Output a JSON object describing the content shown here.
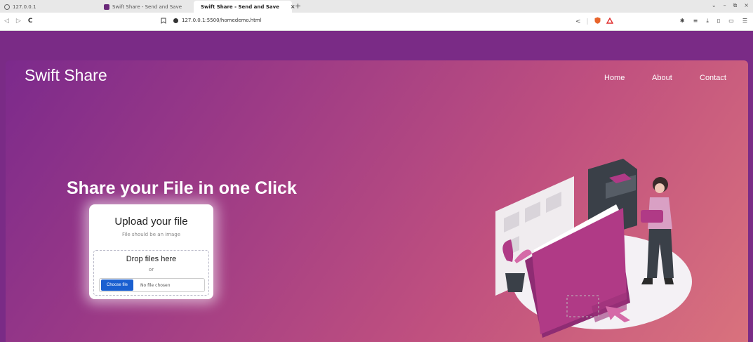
{
  "browser": {
    "tabs": [
      {
        "label": "127.0.0.1",
        "active": false
      },
      {
        "label": "Swift Share - Send and Save",
        "active": false
      },
      {
        "label": "Swift Share - Send and Save",
        "active": true
      }
    ],
    "new_tab": "+",
    "tab_close": "×",
    "url": "127.0.0.1:5500/homedemo.html",
    "window_controls": [
      "⌄",
      "–",
      "⧉",
      "×"
    ]
  },
  "page": {
    "brand": "Swift Share",
    "nav": {
      "home": "Home",
      "about": "About",
      "contact": "Contact"
    },
    "headline": "Share your File in one Click",
    "upload": {
      "title": "Upload your file",
      "subtitle": "File should be an image",
      "drop_title": "Drop files here",
      "or": "or",
      "choose_button": "Choose file",
      "no_file": "No file chosen"
    }
  },
  "colors": {
    "background": "#7a2b86",
    "accent_button": "#1a5fd0",
    "illustration_pink": "#b03a86",
    "illustration_dark": "#3a4048"
  }
}
